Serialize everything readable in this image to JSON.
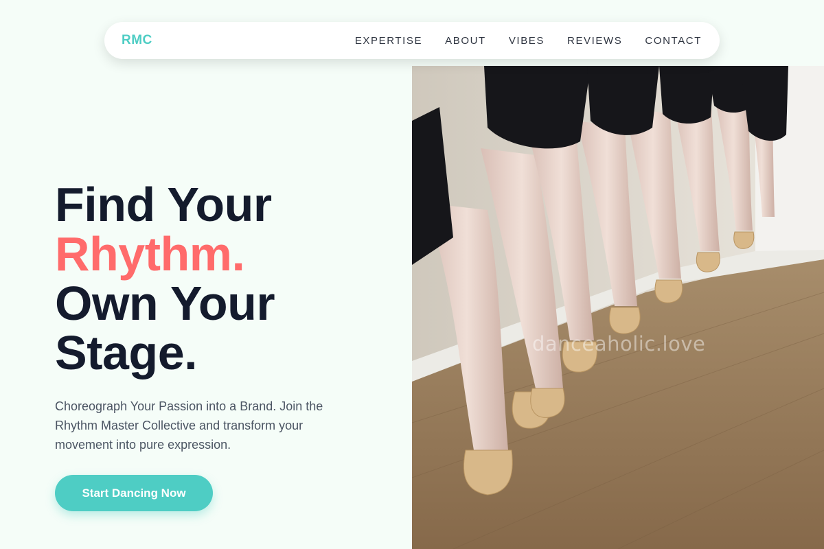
{
  "nav": {
    "logo": "RMC",
    "links": [
      "EXPERTISE",
      "ABOUT",
      "VIBES",
      "REVIEWS",
      "CONTACT"
    ]
  },
  "hero": {
    "line1": "Find Your",
    "line2": "Rhythm.",
    "line3": "Own Your",
    "line4": "Stage.",
    "subtitle": "Choreograph Your Passion into a Brand. Join the Rhythm Master Collective and transform your movement into pure expression.",
    "cta": "Start Dancing Now"
  },
  "image": {
    "subject": "ballet-dancers-pointe-shoes-photo",
    "watermark": "danceaholic.love"
  },
  "colors": {
    "background": "#f5fdf8",
    "brand": "#4ecdc4",
    "accent": "#ff6b6b",
    "heading": "#141b2d"
  }
}
